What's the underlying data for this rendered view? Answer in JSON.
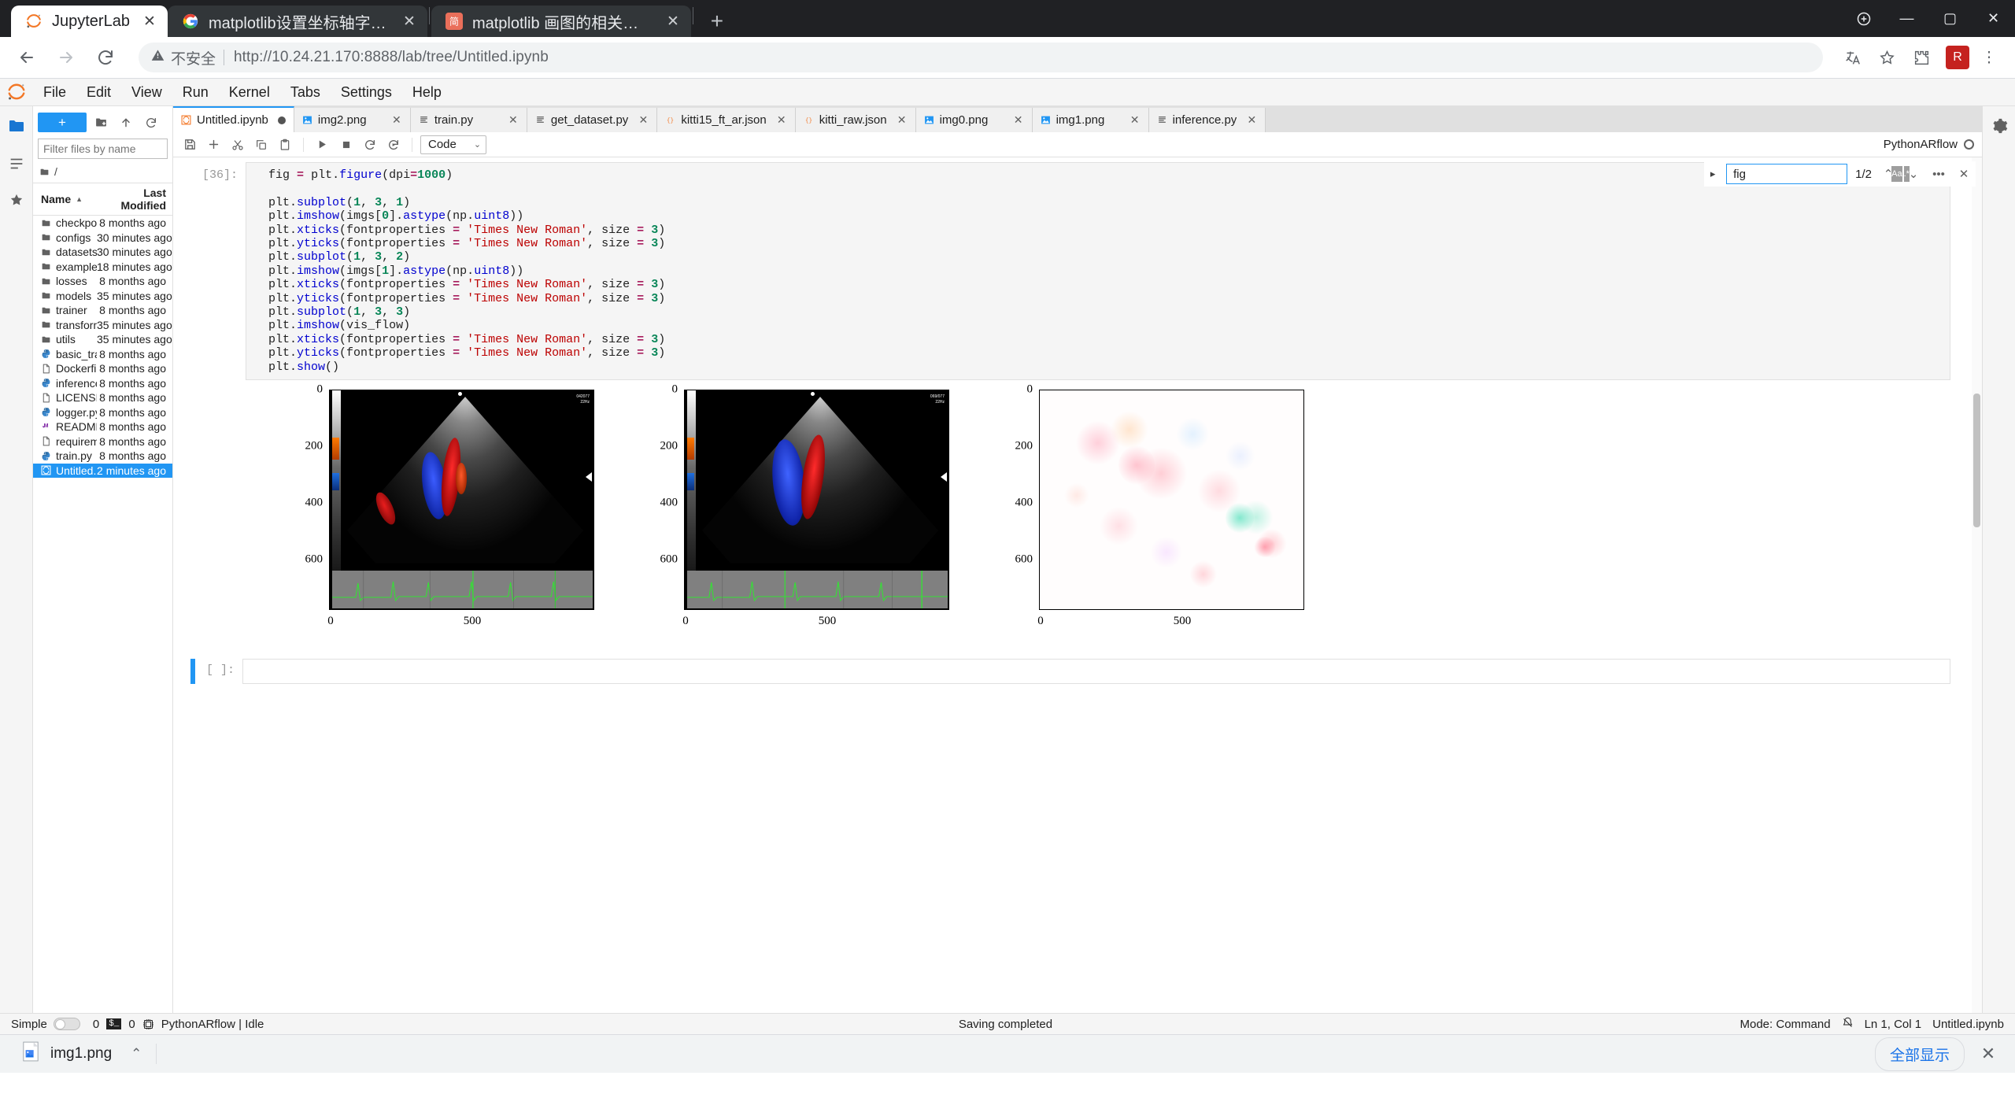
{
  "browser": {
    "tabs": [
      {
        "title": "JupyterLab",
        "favicon": "jupyter-logo-icon",
        "active": true
      },
      {
        "title": "matplotlib设置坐标轴字体大小",
        "favicon": "google-icon",
        "active": false
      },
      {
        "title": "matplotlib 画图的相关设置：坐标",
        "favicon": "jianshu-icon",
        "active": false
      }
    ],
    "new_tab_label": "+",
    "window_controls": [
      "extensions-icon",
      "minimize-icon",
      "maximize-icon",
      "close-icon"
    ],
    "nav": {
      "back": "←",
      "forward": "→",
      "reload": "⟳"
    },
    "omnibox": {
      "warning_icon": "not-secure-icon",
      "warning_text": "不安全",
      "url_scheme": "http://",
      "url_host": "10.24.21.170:8888",
      "url_path": "/lab/tree/Untitled.ipynb",
      "url_full": "http://10.24.21.170:8888/lab/tree/Untitled.ipynb"
    },
    "toolbar_icons": [
      "translate-icon",
      "bookmark-star-icon",
      "extension-puzzle-icon",
      "profile-avatar",
      "more-menu-icon"
    ],
    "avatar_initial": "R"
  },
  "jupyter": {
    "menu": [
      "File",
      "Edit",
      "View",
      "Run",
      "Kernel",
      "Tabs",
      "Settings",
      "Help"
    ],
    "left_launchbar": [
      "file-browser-icon",
      "running-terminals-icon",
      "commands-icon",
      "extensions-icon"
    ],
    "filebrowser": {
      "new_button_label": "+",
      "toolbar_icons": [
        "new-folder-icon",
        "upload-icon",
        "refresh-icon"
      ],
      "filter_placeholder": "Filter files by name",
      "filter_value": "",
      "search_icon": "search-icon",
      "breadcrumb": "/",
      "columns": {
        "name": "Name",
        "modified": "Last Modified"
      },
      "sort_indicator": "▲",
      "items": [
        {
          "name": "checkpoints",
          "modified": "8 months ago",
          "type": "folder",
          "selected": false
        },
        {
          "name": "configs",
          "modified": "30 minutes ago",
          "type": "folder",
          "selected": false
        },
        {
          "name": "datasets",
          "modified": "30 minutes ago",
          "type": "folder",
          "selected": false
        },
        {
          "name": "examples",
          "modified": "18 minutes ago",
          "type": "folder",
          "selected": false
        },
        {
          "name": "losses",
          "modified": "8 months ago",
          "type": "folder",
          "selected": false
        },
        {
          "name": "models",
          "modified": "35 minutes ago",
          "type": "folder",
          "selected": false
        },
        {
          "name": "trainer",
          "modified": "8 months ago",
          "type": "folder",
          "selected": false
        },
        {
          "name": "transforms",
          "modified": "35 minutes ago",
          "type": "folder",
          "selected": false
        },
        {
          "name": "utils",
          "modified": "35 minutes ago",
          "type": "folder",
          "selected": false
        },
        {
          "name": "basic_train....",
          "modified": "8 months ago",
          "type": "python",
          "selected": false
        },
        {
          "name": "Dockerfile",
          "modified": "8 months ago",
          "type": "file",
          "selected": false
        },
        {
          "name": "inference.py",
          "modified": "8 months ago",
          "type": "python",
          "selected": false
        },
        {
          "name": "LICENSE",
          "modified": "8 months ago",
          "type": "file",
          "selected": false
        },
        {
          "name": "logger.py",
          "modified": "8 months ago",
          "type": "python",
          "selected": false
        },
        {
          "name": "README.md",
          "modified": "8 months ago",
          "type": "markdown",
          "selected": false
        },
        {
          "name": "requiremen...",
          "modified": "8 months ago",
          "type": "file",
          "selected": false
        },
        {
          "name": "train.py",
          "modified": "8 months ago",
          "type": "python",
          "selected": false
        },
        {
          "name": "Untitled.ipy...",
          "modified": "2 minutes ago",
          "type": "notebook",
          "selected": true
        }
      ]
    },
    "dock_tabs": [
      {
        "label": "Untitled.ipynb",
        "type": "notebook",
        "active": true,
        "dirty": true
      },
      {
        "label": "img2.png",
        "type": "image",
        "active": false,
        "dirty": false
      },
      {
        "label": "train.py",
        "type": "python",
        "active": false,
        "dirty": false
      },
      {
        "label": "get_dataset.py",
        "type": "python",
        "active": false,
        "dirty": false
      },
      {
        "label": "kitti15_ft_ar.json",
        "type": "json",
        "active": false,
        "dirty": false
      },
      {
        "label": "kitti_raw.json",
        "type": "json",
        "active": false,
        "dirty": false
      },
      {
        "label": "img0.png",
        "type": "image",
        "active": false,
        "dirty": false
      },
      {
        "label": "img1.png",
        "type": "image",
        "active": false,
        "dirty": false
      },
      {
        "label": "inference.py",
        "type": "python",
        "active": false,
        "dirty": false
      }
    ],
    "notebook_toolbar": {
      "buttons": [
        "save-icon",
        "insert-cell-icon",
        "cut-icon",
        "copy-icon",
        "paste-icon",
        "run-icon",
        "stop-icon",
        "restart-icon",
        "restart-run-all-icon"
      ],
      "celltype_value": "Code",
      "celltype_caret": "⌄",
      "kernel_name": "PythonARflow",
      "kernel_status": "idle"
    },
    "search": {
      "caret": "▸",
      "value": "fig",
      "case_toggle": "Aa",
      "regex_toggle": ".*",
      "count": "1/2",
      "prev": "⌃",
      "next": "⌄",
      "more": "•••",
      "close": "✕"
    },
    "cells": [
      {
        "prompt": "[36]:",
        "code_lines": [
          "fig = plt.figure(dpi=1000)",
          "",
          "plt.subplot(1, 3, 1)",
          "plt.imshow(imgs[0].astype(np.uint8))",
          "plt.xticks(fontproperties = 'Times New Roman', size = 3)",
          "plt.yticks(fontproperties = 'Times New Roman', size = 3)",
          "plt.subplot(1, 3, 2)",
          "plt.imshow(imgs[1].astype(np.uint8))",
          "plt.xticks(fontproperties = 'Times New Roman', size = 3)",
          "plt.yticks(fontproperties = 'Times New Roman', size = 3)",
          "plt.subplot(1, 3, 3)",
          "plt.imshow(vis_flow)",
          "plt.xticks(fontproperties = 'Times New Roman', size = 3)",
          "plt.yticks(fontproperties = 'Times New Roman', size = 3)",
          "plt.show()"
        ]
      },
      {
        "prompt": "[ ]:",
        "code_lines": [
          ""
        ]
      }
    ],
    "statusbar": {
      "simple_label": "Simple",
      "simple_on": false,
      "kernel_count": "0",
      "terminal_badge": "$_",
      "terminal_count": "0",
      "cpu_icon": "cpu-icon",
      "kernel_text": "PythonARflow | Idle",
      "message": "Saving completed",
      "mode": "Mode: Command",
      "notif_icon": "notification-bell-off-icon",
      "position": "Ln 1, Col 1",
      "filename": "Untitled.ipynb"
    }
  },
  "download_shelf": {
    "file_icon": "image-file-icon",
    "filename": "img1.png",
    "chevron": "⌃",
    "show_all_label": "全部显示",
    "close_label": "✕"
  },
  "chart_data": {
    "type": "image-grid",
    "title": "",
    "subplots": [
      {
        "index": 1,
        "kind": "ultrasound-echocardiogram-color-doppler",
        "xticks": [
          0,
          500
        ],
        "yticks": [
          0,
          200,
          400,
          600
        ],
        "xlim": [
          0,
          780
        ],
        "ylim": [
          700,
          0
        ],
        "annotations": [
          "042077",
          "22Hz"
        ],
        "tick_fontsize": 3,
        "tick_fontfamily": "Times New Roman"
      },
      {
        "index": 2,
        "kind": "ultrasound-echocardiogram-color-doppler",
        "xticks": [
          0,
          500
        ],
        "yticks": [
          0,
          200,
          400,
          600
        ],
        "xlim": [
          0,
          780
        ],
        "ylim": [
          700,
          0
        ],
        "annotations": [
          "069/077",
          "22Hz"
        ],
        "tick_fontsize": 3,
        "tick_fontfamily": "Times New Roman"
      },
      {
        "index": 3,
        "kind": "optical-flow-visualization",
        "xticks": [
          0,
          500
        ],
        "yticks": [
          0,
          200,
          400,
          600
        ],
        "xlim": [
          0,
          780
        ],
        "ylim": [
          700,
          0
        ],
        "annotations": [],
        "tick_fontsize": 3,
        "tick_fontfamily": "Times New Roman"
      }
    ],
    "figure_dpi": 1000,
    "layout": "1 row × 3 columns"
  }
}
